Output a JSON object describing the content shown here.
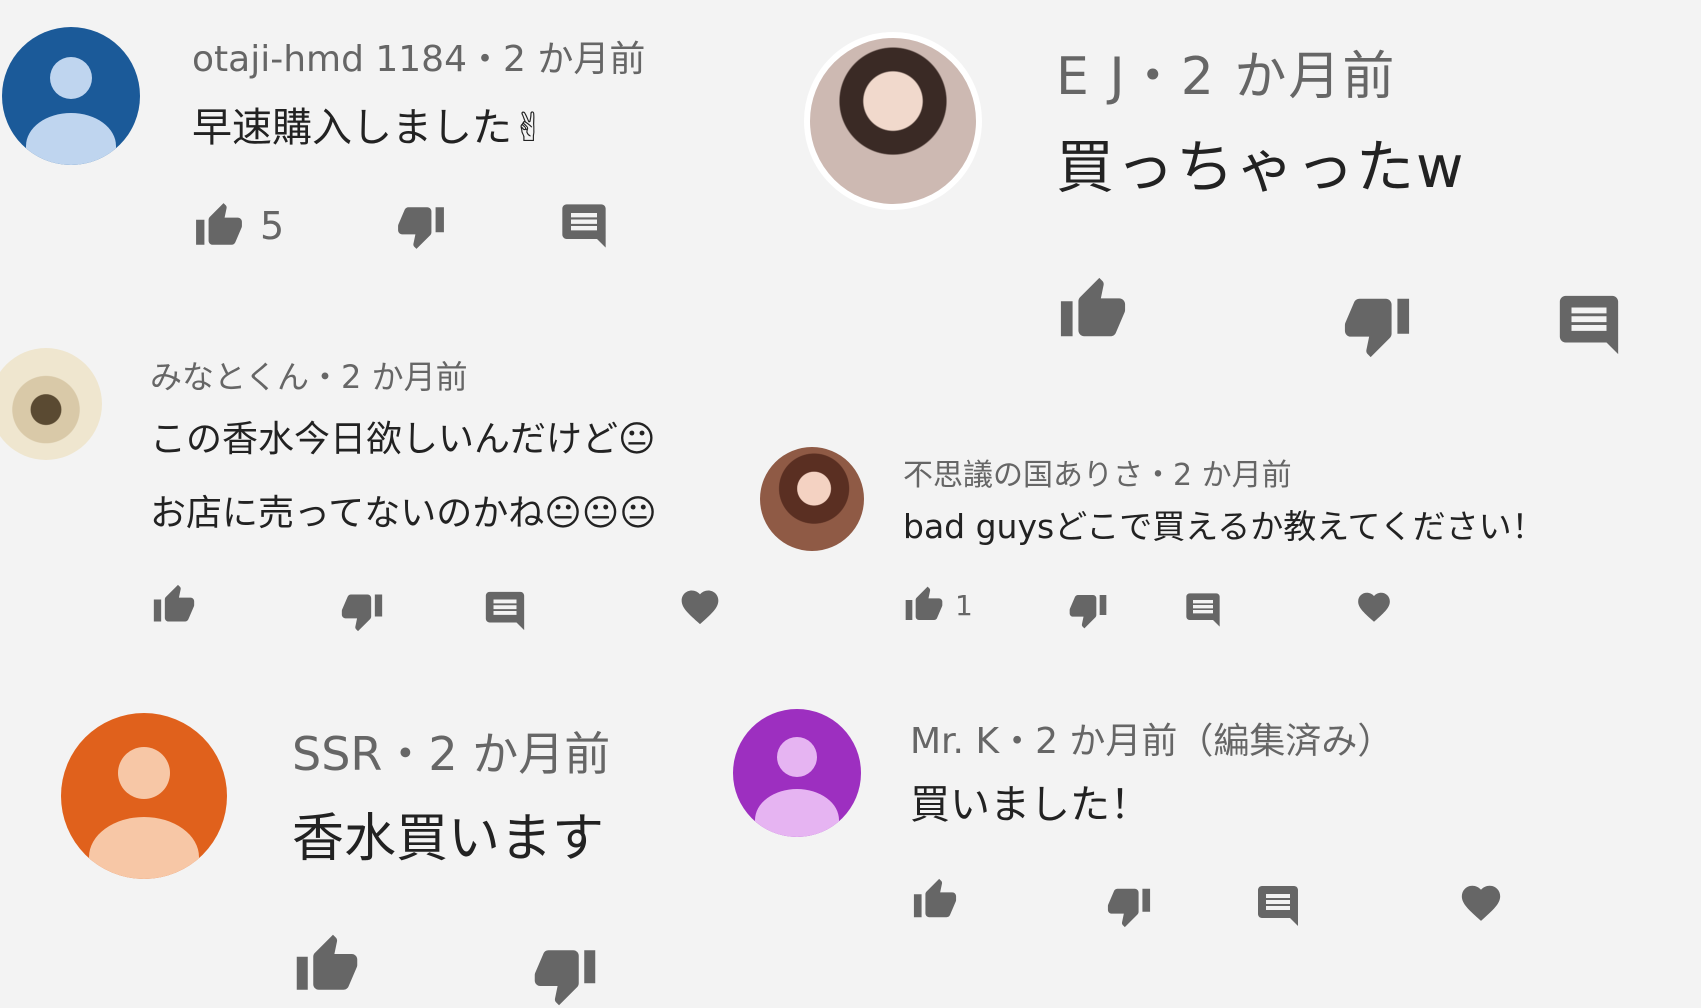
{
  "comments": [
    {
      "author": "otaji-hmd 1184",
      "time": "・2 か月前",
      "text": "早速購入しました✌",
      "likes": "5",
      "avatar_color": "#1b5a99",
      "avatar_light": "#bfd5ef"
    },
    {
      "author": "E J",
      "time": "・2 か月前",
      "text": "買っちゃったw"
    },
    {
      "author": "みなとくん",
      "time": "・2 か月前",
      "text_line1": "この香水今日欲しいんだけど😐",
      "text_line2": "お店に売ってないのかね😐😐😐"
    },
    {
      "author": "不思議の国ありさ",
      "time": "・2 か月前",
      "text": "bad guysどこで買えるか教えてください！",
      "likes": "1"
    },
    {
      "author": "SSR",
      "time": "・2 か月前",
      "text": "香水買います",
      "avatar_color": "#e0611c",
      "avatar_light": "#f7c7a6"
    },
    {
      "author": "Mr. K",
      "time": "・2 か月前（編集済み）",
      "text": "買いました！",
      "avatar_color": "#9d2fc0",
      "avatar_light": "#e6b4f2"
    }
  ],
  "icons": [
    "thumb-up-icon",
    "thumb-down-icon",
    "reply-icon",
    "heart-icon"
  ]
}
